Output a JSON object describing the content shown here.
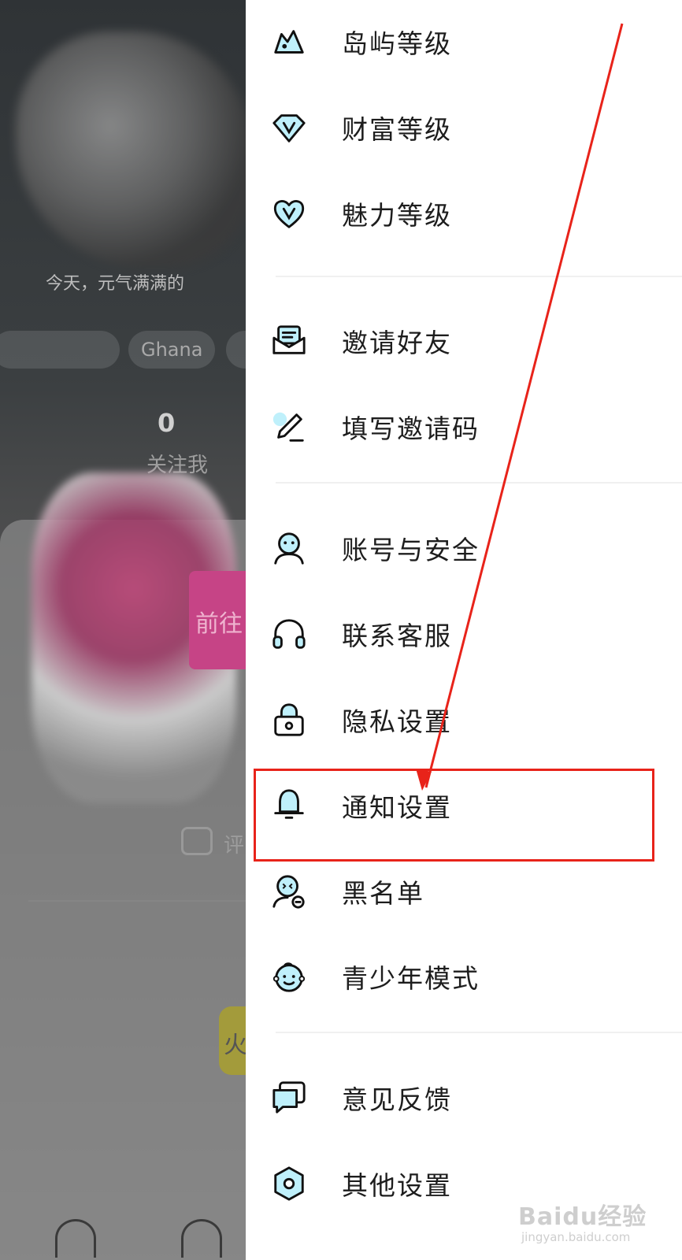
{
  "background": {
    "tag_visible": "Ghana",
    "follow_count": "0",
    "follow_label": "关注我",
    "partial_button_text": "前往",
    "partial_comment_text": "评",
    "partial_caption": "今天，元气满满的"
  },
  "drawer": {
    "group1": [
      {
        "icon": "island-icon",
        "label": "岛屿等级"
      },
      {
        "icon": "wealth-diamond-icon",
        "label": "财富等级"
      },
      {
        "icon": "charm-heart-icon",
        "label": "魅力等级"
      }
    ],
    "group2": [
      {
        "icon": "invite-envelope-icon",
        "label": "邀请好友"
      },
      {
        "icon": "pencil-icon",
        "label": "填写邀请码"
      }
    ],
    "group3": [
      {
        "icon": "account-user-icon",
        "label": "账号与安全"
      },
      {
        "icon": "headset-icon",
        "label": "联系客服"
      },
      {
        "icon": "lock-icon",
        "label": "隐私设置"
      },
      {
        "icon": "bell-icon",
        "label": "通知设置"
      },
      {
        "icon": "blocked-user-icon",
        "label": "黑名单"
      },
      {
        "icon": "child-face-icon",
        "label": "青少年模式"
      }
    ],
    "group4": [
      {
        "icon": "feedback-chat-icon",
        "label": "意见反馈"
      },
      {
        "icon": "hexagon-settings-icon",
        "label": "其他设置"
      }
    ]
  },
  "annotation": {
    "highlighted_item": "通知设置",
    "color": "#e8231a"
  },
  "watermark": {
    "main": "Baidu经验",
    "sub": "jingyan.baidu.com"
  },
  "colors": {
    "accent_cyan": "#4fd3ee",
    "text": "#1d1d1d"
  }
}
